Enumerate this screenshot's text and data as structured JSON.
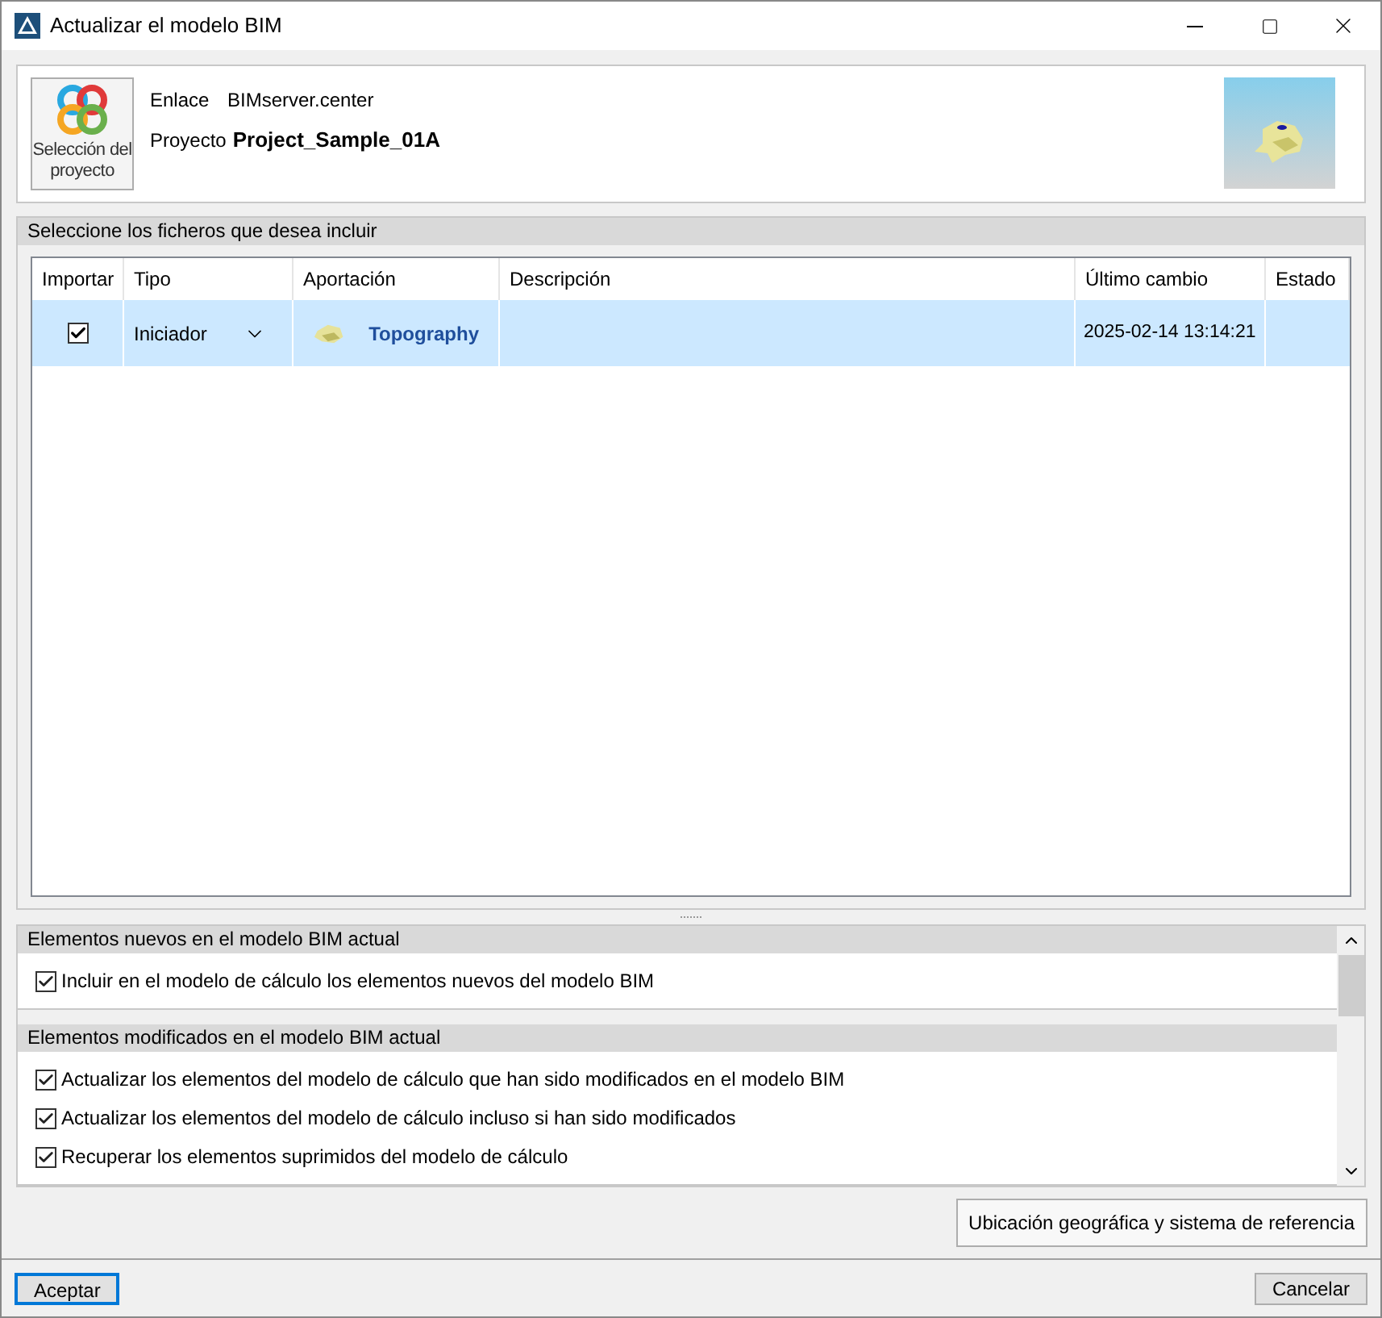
{
  "window": {
    "title": "Actualizar el modelo BIM"
  },
  "project": {
    "button_label": "Selección del proyecto",
    "fields": [
      {
        "label": "Enlace",
        "value": "BIMserver.center",
        "bold": false
      },
      {
        "label": "Proyecto",
        "value": "Project_Sample_01A",
        "bold": true
      }
    ]
  },
  "files": {
    "title": "Seleccione los ficheros que desea incluir",
    "columns": [
      "Importar",
      "Tipo",
      "Aportación",
      "Descripción",
      "Último cambio",
      "Estado"
    ],
    "rows": [
      {
        "selected": true,
        "checked": true,
        "type": "Iniciador",
        "contribution": "Topography",
        "modified": "2025-02-14 13:14:21"
      }
    ]
  },
  "option_groups": [
    {
      "title": "Elementos nuevos en el modelo BIM actual",
      "options": [
        {
          "label": "Incluir en el modelo de cálculo los elementos nuevos del modelo BIM",
          "checked": true
        }
      ]
    },
    {
      "title": "Elementos modificados en el modelo BIM actual",
      "options": [
        {
          "label": "Actualizar los elementos del modelo de cálculo que han sido modificados en el modelo BIM",
          "checked": true
        },
        {
          "label": "Actualizar los elementos del modelo de cálculo incluso si han sido modificados",
          "checked": true
        },
        {
          "label": "Recuperar los elementos suprimidos del modelo de cálculo",
          "checked": true
        }
      ]
    }
  ],
  "geo_button": "Ubicación geográfica y sistema de referencia",
  "buttons": [
    {
      "label": "Aceptar",
      "default": true
    },
    {
      "label": "Cancelar",
      "default": false
    }
  ]
}
